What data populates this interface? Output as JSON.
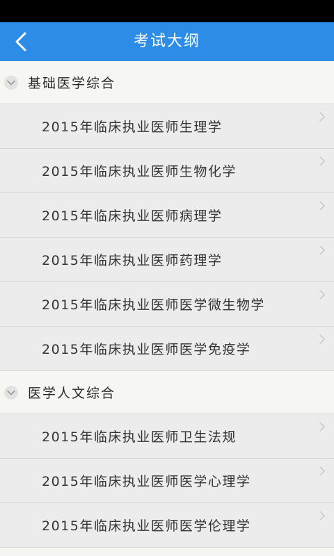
{
  "header": {
    "title": "考试大纲",
    "back_icon": "chevron-left-icon"
  },
  "colors": {
    "accent": "#2d8ce6",
    "status_bar": "#000000",
    "group_bg": "#f6f6f3",
    "item_bg": "#ececec"
  },
  "groups": [
    {
      "label": "基础医学综合",
      "expanded": true,
      "items": [
        {
          "label": "2015年临床执业医师生理学"
        },
        {
          "label": "2015年临床执业医师生物化学"
        },
        {
          "label": "2015年临床执业医师病理学"
        },
        {
          "label": "2015年临床执业医师药理学"
        },
        {
          "label": "2015年临床执业医师医学微生物学"
        },
        {
          "label": "2015年临床执业医师医学免疫学"
        }
      ]
    },
    {
      "label": "医学人文综合",
      "expanded": true,
      "items": [
        {
          "label": "2015年临床执业医师卫生法规"
        },
        {
          "label": "2015年临床执业医师医学心理学"
        },
        {
          "label": "2015年临床执业医师医学伦理学"
        }
      ]
    }
  ]
}
